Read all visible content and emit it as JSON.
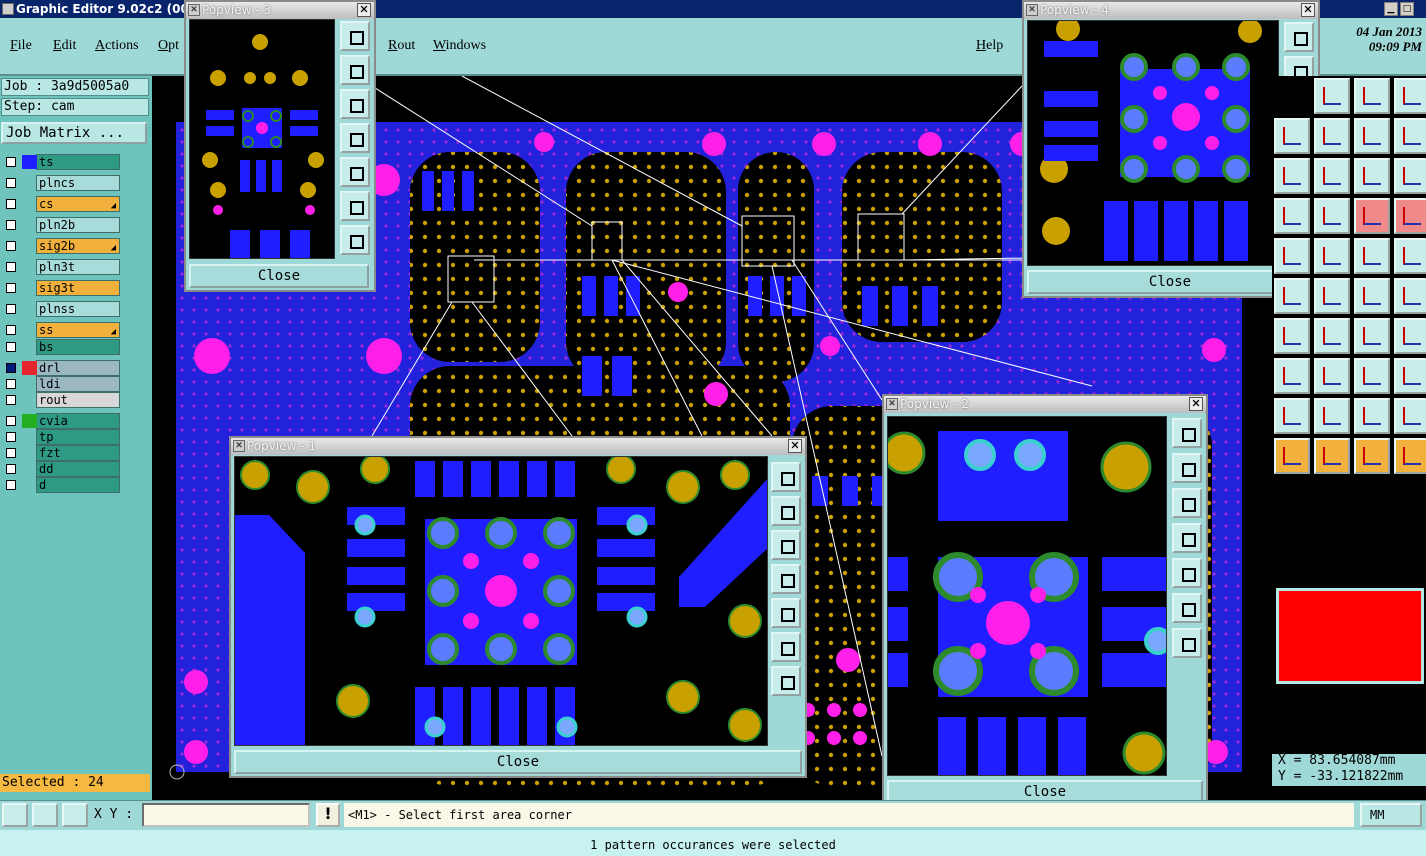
{
  "window": {
    "title": "Graphic Editor 9.02c2 (00@HY"
  },
  "menu": {
    "items": [
      "File",
      "Edit",
      "Actions",
      "Opt",
      "Rout",
      "Windows"
    ],
    "help": "Help",
    "date": "04 Jan 2013",
    "time": "09:09 PM"
  },
  "job": {
    "job_line": "Job : 3a9d5005a0",
    "step_line": "Step: cam",
    "matrix_button": "Job Matrix ..."
  },
  "layers": [
    {
      "name": "ts",
      "color": "#2f9a84",
      "swatch": "#1e1eff",
      "checked": false
    },
    {
      "name": "plncs",
      "color": "#a7dcda",
      "swatch": "",
      "checked": false
    },
    {
      "name": "cs",
      "color": "#f2b13c",
      "swatch": "",
      "checked": false,
      "marker": true
    },
    {
      "name": "pln2b",
      "color": "#a7dcda",
      "swatch": "",
      "checked": false
    },
    {
      "name": "sig2b",
      "color": "#f2b13c",
      "swatch": "",
      "checked": false,
      "marker": true
    },
    {
      "name": "pln3t",
      "color": "#a7dcda",
      "swatch": "",
      "checked": false
    },
    {
      "name": "sig3t",
      "color": "#f2b13c",
      "swatch": "",
      "checked": false
    },
    {
      "name": "plnss",
      "color": "#a7dcda",
      "swatch": "",
      "checked": false
    },
    {
      "name": "ss",
      "color": "#f2b13c",
      "swatch": "",
      "checked": false,
      "marker": true
    },
    {
      "name": "bs",
      "color": "#2f9a84",
      "swatch": "",
      "checked": false
    },
    {
      "name": "drl",
      "color": "#9bb7c2",
      "swatch": "#e6262f",
      "checked": true
    },
    {
      "name": "ldi",
      "color": "#9bb7c2",
      "swatch": "",
      "checked": false
    },
    {
      "name": "rout",
      "color": "#d8d8d8",
      "swatch": "",
      "checked": false
    },
    {
      "name": "cvia",
      "color": "#2f9a84",
      "swatch": "#22b022",
      "checked": false
    },
    {
      "name": "tp",
      "color": "#2f9a84",
      "swatch": "",
      "checked": false
    },
    {
      "name": "fzt",
      "color": "#2f9a84",
      "swatch": "",
      "checked": false
    },
    {
      "name": "dd",
      "color": "#2f9a84",
      "swatch": "",
      "checked": false
    },
    {
      "name": "d",
      "color": "#2f9a84",
      "swatch": "",
      "checked": false
    }
  ],
  "selected_text": "Selected : 24",
  "popups": {
    "p1": {
      "title": "Popview - 1",
      "close": "Close"
    },
    "p2": {
      "title": "Popview - 2",
      "close": "Close"
    },
    "p3": {
      "title": "Popview - 3",
      "close": "Close"
    },
    "p4": {
      "title": "Popview - 4",
      "close": "Close"
    }
  },
  "coords": {
    "x": "X = 83.654087mm",
    "y": "Y = -33.121822mm"
  },
  "bottom": {
    "xy_label": "X Y :",
    "xy_value": "",
    "prompt": "<M1> - Select first area corner",
    "units": "MM"
  },
  "status": "1 pattern occurances were selected",
  "colors": {
    "panel": "#9fd9d7",
    "pad_blue": "#1e1eff",
    "via_gold": "#c8a000",
    "drill_magenta": "#ff1fe8",
    "board_blue": "#2222dd"
  }
}
